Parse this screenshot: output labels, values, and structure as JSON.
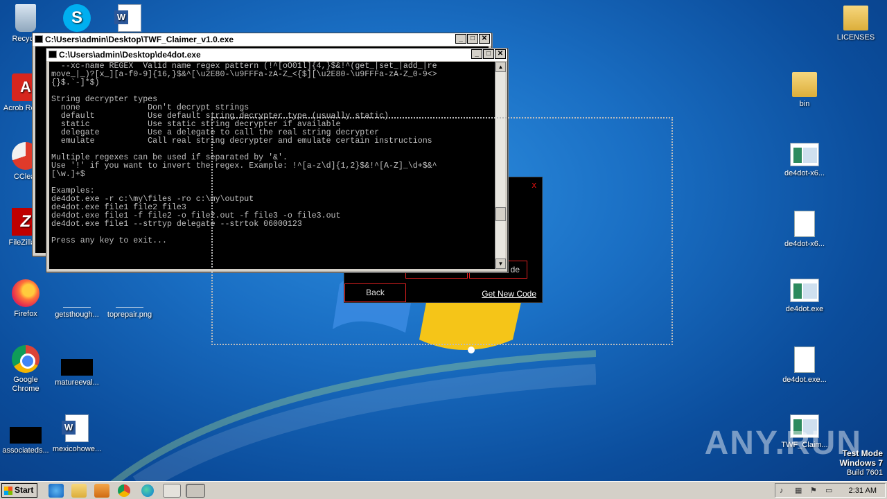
{
  "desktop_icons_left": [
    {
      "label": "Recycle",
      "icon": "recycle-bin-icon"
    },
    {
      "label": "Acrob Reade",
      "icon": "acrobat-icon"
    },
    {
      "label": "CClear",
      "icon": "ccleaner-icon"
    },
    {
      "label": "FileZilla C",
      "icon": "filezilla-icon"
    },
    {
      "label": "Firefox",
      "icon": "firefox-icon"
    },
    {
      "label": "Google Chrome",
      "icon": "chrome-icon"
    },
    {
      "label": "associateds...",
      "icon": "black-thumbnail-icon"
    }
  ],
  "desktop_icons_mid": [
    {
      "label": "getsthough...",
      "icon": "file-icon"
    },
    {
      "label": "toprepair.png",
      "icon": "png-file-icon"
    },
    {
      "label": "matureeval...",
      "icon": "black-thumbnail-icon"
    },
    {
      "label": "mexicohowe...",
      "icon": "word-document-icon"
    }
  ],
  "desktop_icons_right": [
    {
      "label": "LICENSES",
      "icon": "folder-icon"
    },
    {
      "label": "bin",
      "icon": "folder-icon"
    },
    {
      "label": "de4dot-x6...",
      "icon": "exe-icon"
    },
    {
      "label": "de4dot-x6...",
      "icon": "file-icon"
    },
    {
      "label": "de4dot.exe",
      "icon": "exe-icon"
    },
    {
      "label": "de4dot.exe...",
      "icon": "file-icon"
    },
    {
      "label": "TWF_Claim...",
      "icon": "exe-icon"
    }
  ],
  "window_back": {
    "title": "C:\\Users\\admin\\Desktop\\TWF_Claimer_v1.0.exe"
  },
  "window_front": {
    "title": "C:\\Users\\admin\\Desktop\\de4dot.exe"
  },
  "console_lines": [
    "  --xc-name REGEX  Valid name regex pattern (!^[oO01l]{4,}$&!^(get_|set_|add_|re",
    "move_|_)?[x_][a-f0-9]{16,}$&^[\\u2E80-\\u9FFFa-zA-Z_<{$][\\u2E80-\\u9FFFa-zA-Z_0-9<>",
    "{}$.`-]*$)",
    "",
    "String decrypter types",
    "  none              Don't decrypt strings",
    "  default           Use default string decrypter type (usually static)",
    "  static            Use static string decrypter if available",
    "  delegate          Use a delegate to call the real string decrypter",
    "  emulate           Call real string decrypter and emulate certain instructions",
    "",
    "Multiple regexes can be used if separated by '&'.",
    "Use '!' if you want to invert the regex. Example: !^[a-z\\d]{1,2}$&!^[A-Z]_\\d+$&^",
    "[\\w.]+$",
    "",
    "Examples:",
    "de4dot.exe -r c:\\my\\files -ro c:\\my\\output",
    "de4dot.exe file1 file2 file3",
    "de4dot.exe file1 -f file2 -o file2.out -f file3 -o file3.out",
    "de4dot.exe file1 --strtyp delegate --strtok 06000123",
    "",
    "Press any key to exit..."
  ],
  "claimer_app": {
    "close_glyph": "x",
    "partial_button_label": "de",
    "back_label": "Back",
    "get_new_code_label": "Get New Code"
  },
  "watermark": "ANY.RUN",
  "test_mode": {
    "line1": "Test Mode",
    "line2": "Windows 7",
    "line3": "Build 7601"
  },
  "taskbar": {
    "start_label": "Start",
    "clock": "2:31 AM"
  }
}
